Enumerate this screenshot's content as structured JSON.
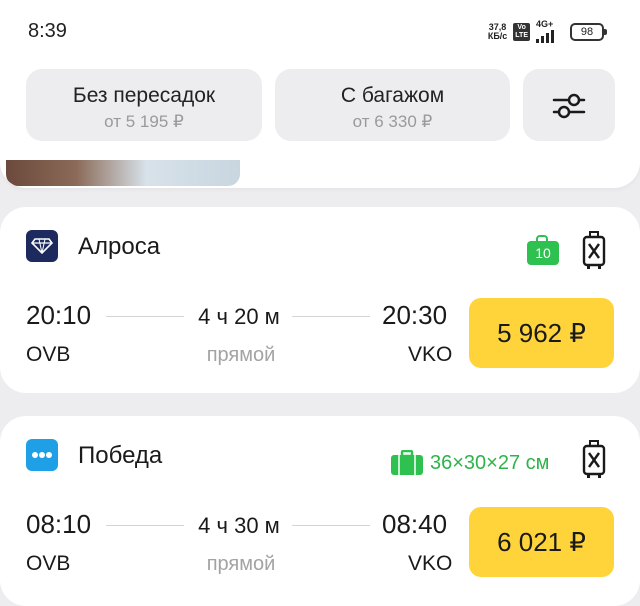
{
  "status_bar": {
    "time": "8:39",
    "net_speed_top": "37,8",
    "net_speed_bottom": "КБ/с",
    "volte_top": "Vo",
    "volte_bottom": "LTE",
    "network": "4G+",
    "battery": "98"
  },
  "filters": [
    {
      "title": "Без пересадок",
      "subtitle": "от 5 195 ₽"
    },
    {
      "title": "С багажом",
      "subtitle": "от 6 330 ₽"
    }
  ],
  "filter_settings_icon": "sliders-icon",
  "flights": [
    {
      "airline": "Алроса",
      "logo_icon": "diamond-icon",
      "baggage_label": "10",
      "departure_time": "20:10",
      "departure_code": "OVB",
      "duration": "4 ч 20 м",
      "stops": "прямой",
      "arrival_time": "20:30",
      "arrival_code": "VKO",
      "price": "5 962 ₽"
    },
    {
      "airline": "Победа",
      "logo_icon": "dots-icon",
      "baggage_label": "36×30×27 см",
      "departure_time": "08:10",
      "departure_code": "OVB",
      "duration": "4 ч 30 м",
      "stops": "прямой",
      "arrival_time": "08:40",
      "arrival_code": "VKO",
      "price": "6 021 ₽"
    }
  ],
  "colors": {
    "price_button": "#ffd43b",
    "baggage_green": "#2fc150",
    "background": "#ededf0"
  }
}
